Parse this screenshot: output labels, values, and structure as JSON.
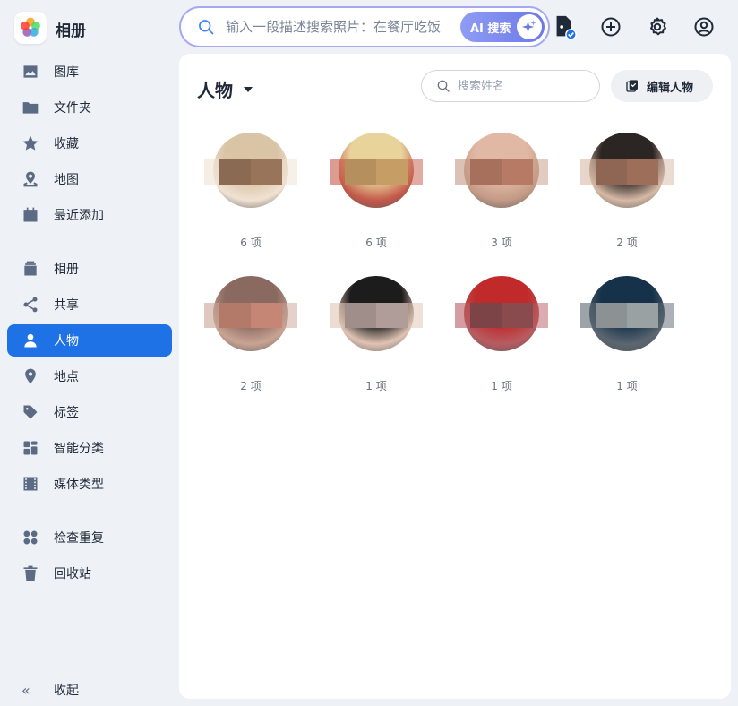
{
  "app": {
    "title": "相册"
  },
  "search": {
    "placeholder": "输入一段描述搜索照片：在餐厅吃饭",
    "ai_label": "AI 搜索"
  },
  "sidebar": {
    "groups": [
      [
        {
          "label": "图库",
          "icon": "gallery-icon"
        },
        {
          "label": "文件夹",
          "icon": "folder-icon"
        },
        {
          "label": "收藏",
          "icon": "star-icon"
        },
        {
          "label": "地图",
          "icon": "map-icon"
        },
        {
          "label": "最近添加",
          "icon": "calendar-icon"
        }
      ],
      [
        {
          "label": "相册",
          "icon": "album-icon"
        },
        {
          "label": "共享",
          "icon": "share-icon"
        },
        {
          "label": "人物",
          "icon": "person-icon",
          "active": true
        },
        {
          "label": "地点",
          "icon": "location-pin-icon"
        },
        {
          "label": "标签",
          "icon": "tag-icon"
        },
        {
          "label": "智能分类",
          "icon": "smart-category-icon"
        },
        {
          "label": "媒体类型",
          "icon": "film-icon"
        }
      ],
      [
        {
          "label": "检查重复",
          "icon": "duplicate-icon"
        },
        {
          "label": "回收站",
          "icon": "trash-icon"
        }
      ]
    ],
    "collapse_label": "收起"
  },
  "main": {
    "title": "人物",
    "name_search_placeholder": "搜索姓名",
    "edit_label": "编辑人物",
    "people": [
      {
        "count": "6 项",
        "colors": [
          "#d9c4a6",
          "#8a6a52",
          "#f0e2d2"
        ]
      },
      {
        "count": "6 项",
        "colors": [
          "#e8d39a",
          "#b58f5d",
          "#c45a4a"
        ]
      },
      {
        "count": "3 项",
        "colors": [
          "#e0b8a4",
          "#a6705c",
          "#c39a86"
        ]
      },
      {
        "count": "2 项",
        "colors": [
          "#2b2523",
          "#8f6553",
          "#d7b9a5"
        ]
      },
      {
        "count": "2 项",
        "colors": [
          "#8a6a60",
          "#b37a6a",
          "#c9a494"
        ]
      },
      {
        "count": "1 项",
        "colors": [
          "#1c1c1c",
          "#a08e8a",
          "#e0c4b4"
        ]
      },
      {
        "count": "1 项",
        "colors": [
          "#c02a2a",
          "#7d4448",
          "#b75c62"
        ]
      },
      {
        "count": "1 项",
        "colors": [
          "#16324a",
          "#8c9294",
          "#5a6670"
        ]
      }
    ]
  }
}
